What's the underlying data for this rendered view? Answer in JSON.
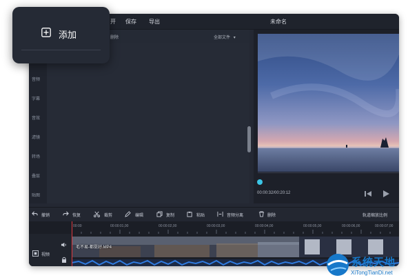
{
  "popup": {
    "add_label": "添加"
  },
  "menu": {
    "items": [
      "开",
      "保存",
      "导出"
    ],
    "title": "未命名"
  },
  "library": {
    "delete_label": "删除",
    "filter_label": "全部文件",
    "filter_arrow": "▾",
    "sidebar": [
      "音频",
      "字幕",
      "音效",
      "滤镜",
      "转场",
      "叠层",
      "贴图"
    ]
  },
  "preview": {
    "time": "00:00:32/00:20:12",
    "progress": 0.0
  },
  "actions": {
    "undo": "撤销",
    "redo": "恢复",
    "cut": "裁剪",
    "edit": "编辑",
    "copy": "复制",
    "paste": "粘贴",
    "audio_split": "音频分离",
    "delete": "删除",
    "ratio": "轨道缩放比例"
  },
  "timeline": {
    "ticks": [
      "00:00",
      "00:00:01,00",
      "00:00:02,00",
      "00:00:03,00",
      "00:00:04,00",
      "00:00:05,00",
      "00:00:06,00",
      "00:00:07,00",
      "00:00:08,00"
    ],
    "track_label": "视频",
    "clip_name": "毛不易-都挺好.MP4"
  },
  "watermark": {
    "cn": "系统天地",
    "en": "XiTongTianDi.net"
  },
  "colors": {
    "accent": "#3bc5e6",
    "playhead": "#e0393e",
    "brand": "#1778c9"
  }
}
